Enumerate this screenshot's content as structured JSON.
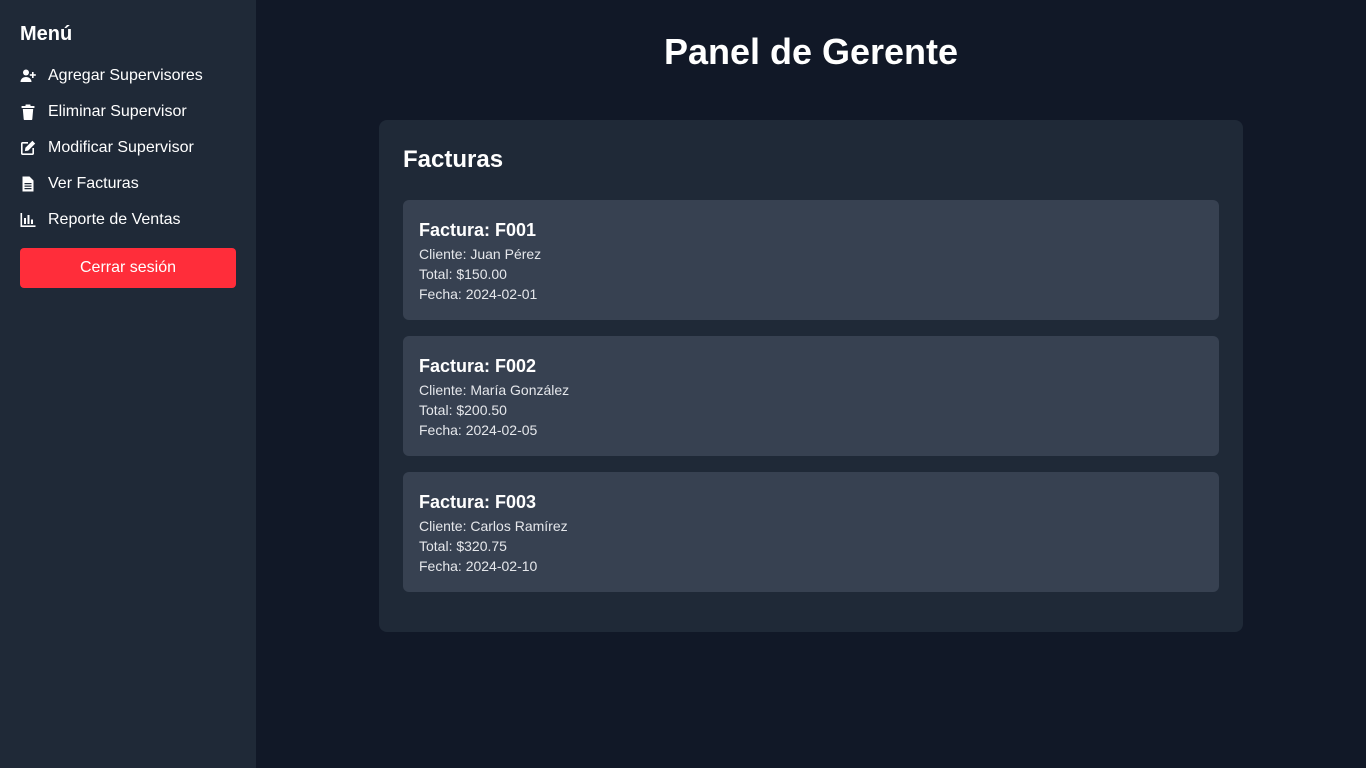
{
  "sidebar": {
    "title": "Menú",
    "items": [
      {
        "label": "Agregar Supervisores",
        "icon": "user-plus-icon"
      },
      {
        "label": "Eliminar Supervisor",
        "icon": "trash-icon"
      },
      {
        "label": "Modificar Supervisor",
        "icon": "edit-icon"
      },
      {
        "label": "Ver Facturas",
        "icon": "file-icon"
      },
      {
        "label": "Reporte de Ventas",
        "icon": "bar-chart-icon"
      }
    ],
    "logout_label": "Cerrar sesión"
  },
  "main": {
    "title": "Panel de Gerente",
    "panel_title": "Facturas",
    "invoices": [
      {
        "title": "Factura: F001",
        "client": "Cliente: Juan Pérez",
        "total": "Total: $150.00",
        "date": "Fecha: 2024-02-01"
      },
      {
        "title": "Factura: F002",
        "client": "Cliente: María González",
        "total": "Total: $200.50",
        "date": "Fecha: 2024-02-05"
      },
      {
        "title": "Factura: F003",
        "client": "Cliente: Carlos Ramírez",
        "total": "Total: $320.75",
        "date": "Fecha: 2024-02-10"
      }
    ]
  },
  "colors": {
    "background": "#111827",
    "sidebar": "#1f2937",
    "card": "#374151",
    "logout": "#ff2d3a"
  }
}
